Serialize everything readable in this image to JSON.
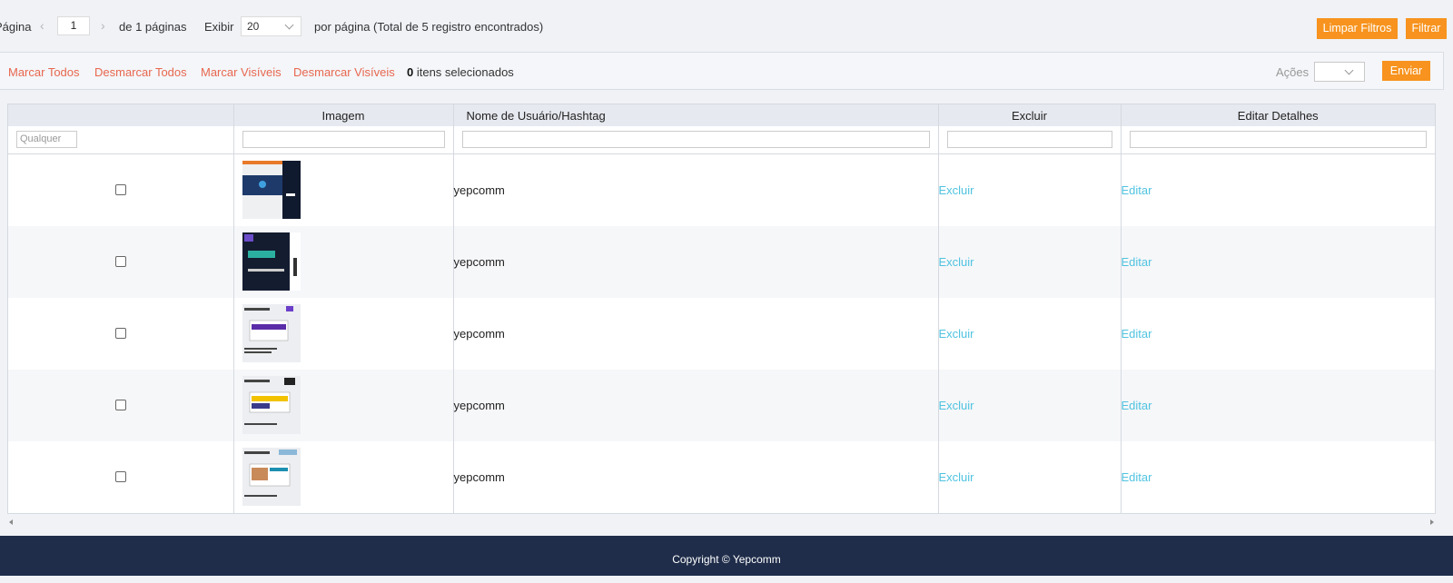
{
  "pager": {
    "page_label": "Página",
    "page_value": "1",
    "of_pages": "de 1 páginas",
    "show_label": "Exibir",
    "per_page_value": "20",
    "per_page_text": "por página (Total de 5 registro encontrados)",
    "clear_filters": "Limpar Filtros",
    "filter": "Filtrar"
  },
  "actions": {
    "mark_all": "Marcar Todos",
    "unmark_all": "Desmarcar Todos",
    "mark_visible": "Marcar Visíveis",
    "unmark_visible": "Desmarcar Visíveis",
    "selected_count": "0",
    "selected_text": " itens selecionados",
    "acoes_label": "Ações",
    "acoes_value": "",
    "send": "Enviar"
  },
  "table": {
    "columns": [
      "",
      "Imagem",
      "Nome de Usuário/Hashtag",
      "Excluir",
      "Editar Detalhes"
    ],
    "any_placeholder": "Qualquer",
    "rows": [
      {
        "user": "yepcomm",
        "delete": "Excluir",
        "edit": "Editar"
      },
      {
        "user": "yepcomm",
        "delete": "Excluir",
        "edit": "Editar"
      },
      {
        "user": "yepcomm",
        "delete": "Excluir",
        "edit": "Editar"
      },
      {
        "user": "yepcomm",
        "delete": "Excluir",
        "edit": "Editar"
      },
      {
        "user": "yepcomm",
        "delete": "Excluir",
        "edit": "Editar"
      }
    ]
  },
  "footer": {
    "copyright": "Copyright © Yepcomm"
  },
  "colors": {
    "accent_orange": "#f7931e",
    "link_red": "#e8674f",
    "link_cyan": "#4fc3e0",
    "footer_bg": "#1f2d4a"
  }
}
